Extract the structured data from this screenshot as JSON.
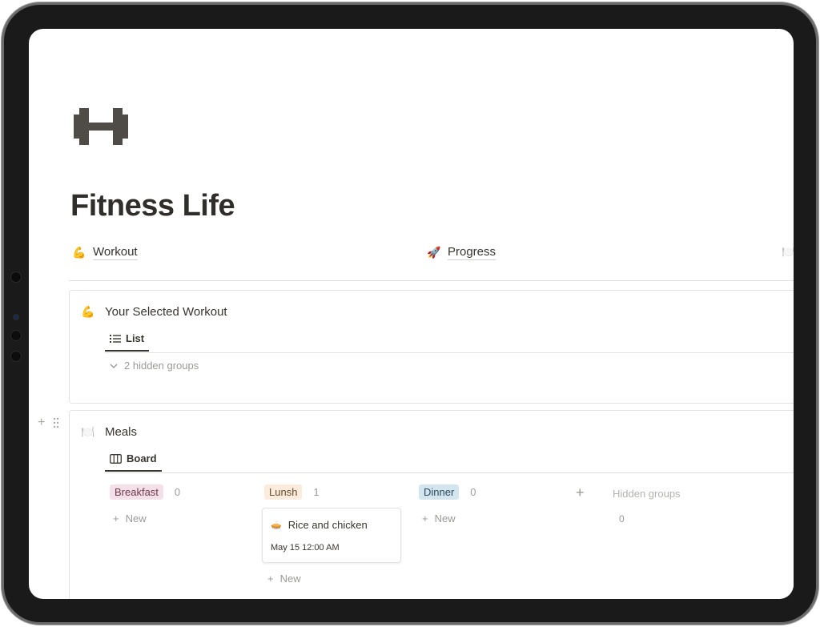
{
  "page": {
    "title": "Fitness Life"
  },
  "links": [
    {
      "emoji": "💪",
      "label": "Workout"
    },
    {
      "emoji": "🚀",
      "label": "Progress"
    },
    {
      "emoji": "🍽️",
      "label": ""
    }
  ],
  "workout_block": {
    "emoji": "💪",
    "title": "Your Selected Workout",
    "view_label": "List",
    "hidden_groups_label": "2 hidden groups"
  },
  "meals_block": {
    "emoji": "🍽️",
    "title": "Meals",
    "view_label": "Board",
    "columns": [
      {
        "label": "Breakfast",
        "count": "0",
        "new_label": "New"
      },
      {
        "label": "Lunsh",
        "count": "1",
        "new_label": "New"
      },
      {
        "label": "Dinner",
        "count": "0",
        "new_label": "New"
      }
    ],
    "card": {
      "emoji": "🥧",
      "title": "Rice and chicken",
      "date": "May 15 12:00 AM"
    },
    "hidden_groups_label": "Hidden groups",
    "hidden_groups_count": "0"
  },
  "colors": {
    "text": "#37352f",
    "muted": "#9b9a97",
    "breakfast_tag": "#f5e0e9",
    "lunsh_tag": "#fbecdd",
    "dinner_tag": "#d3e5ef"
  },
  "icons": [
    "dumbbell-icon",
    "list-icon",
    "board-icon",
    "chevron-down-icon",
    "plus-icon",
    "drag-handle-icon"
  ]
}
